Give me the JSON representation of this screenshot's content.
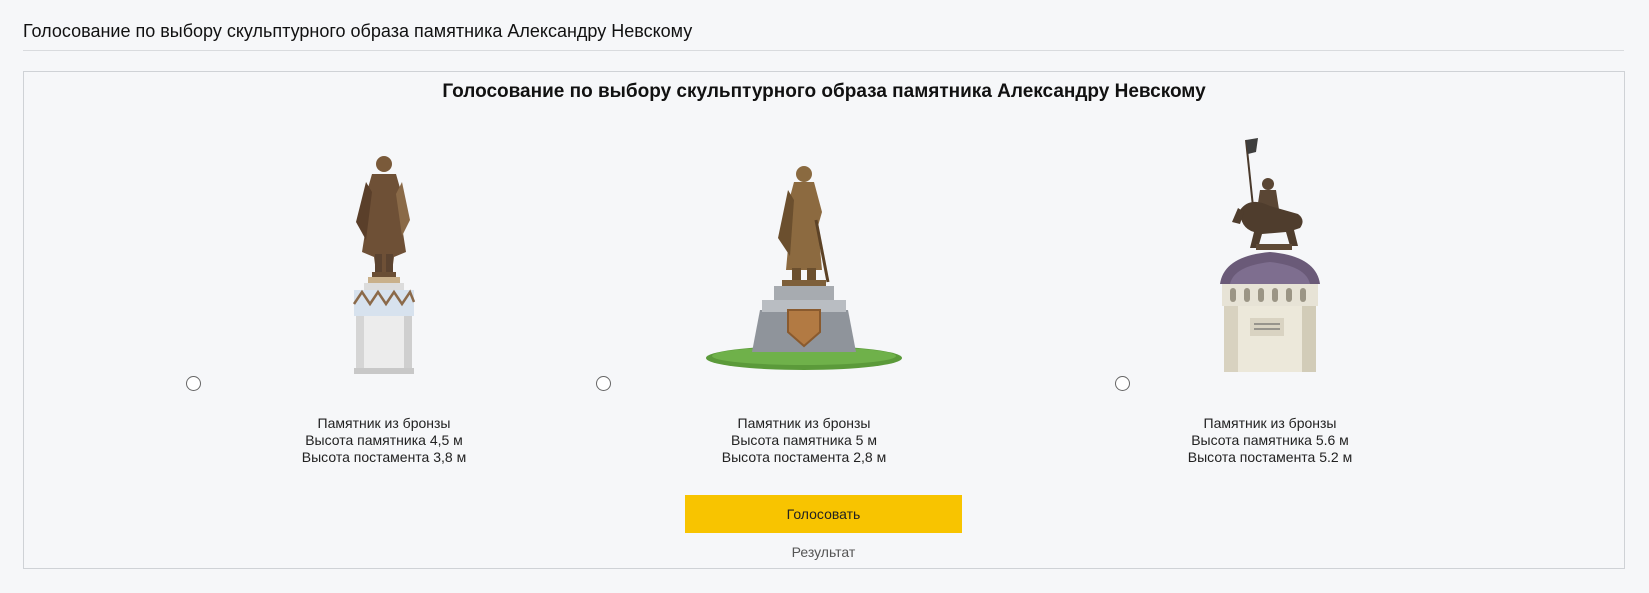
{
  "header": {
    "title": "Голосование по выбору скульптурного образа памятника Александру Невскому"
  },
  "poll": {
    "title": "Голосование по выбору скульптурного образа памятника Александру Невскому",
    "options": [
      {
        "line1": "Памятник из бронзы",
        "line2": "Высота памятника 4,5 м",
        "line3": "Высота постамента 3,8 м",
        "image": "statue-standing-on-round-pedestal"
      },
      {
        "line1": "Памятник из бронзы",
        "line2": "Высота памятника 5 м",
        "line3": "Высота постамента 2,8 м",
        "image": "statue-with-sword-on-stepped-pedestal"
      },
      {
        "line1": "Памятник из бронзы",
        "line2": "Высота памятника 5.6 м",
        "line3": "Высота постамента 5.2 м",
        "image": "equestrian-statue-on-tower-pedestal"
      }
    ],
    "vote_label": "Голосовать",
    "result_label": "Результат"
  },
  "colors": {
    "vote_button": "#f8c400",
    "bronze": "#8a6a45",
    "pedestal_stone": "#e6e6e6",
    "grass": "#5b9a3a"
  }
}
